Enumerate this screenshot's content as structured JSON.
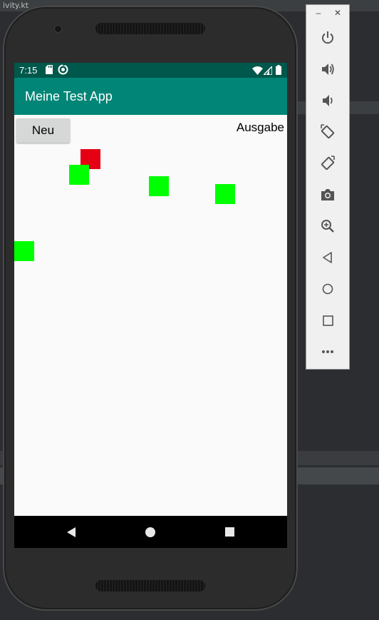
{
  "ide": {
    "tab_label": "ivity.kt"
  },
  "status_bar": {
    "time": "7:15",
    "icons": [
      "sd-card-icon",
      "sync-icon",
      "wifi-icon",
      "signal-icon",
      "battery-icon"
    ]
  },
  "app": {
    "title": "Meine Test App",
    "neu_button_label": "Neu",
    "ausgabe_label": "Ausgabe"
  },
  "colors": {
    "status_bar": "#00574b",
    "app_bar": "#008577",
    "green_square": "#00ff00",
    "red_square": "#e50013"
  },
  "squares": [
    {
      "color": "red",
      "name": "red-square"
    },
    {
      "color": "green",
      "name": "green-square"
    },
    {
      "color": "green",
      "name": "green-square"
    },
    {
      "color": "green",
      "name": "green-square"
    },
    {
      "color": "green",
      "name": "green-square"
    }
  ],
  "nav_bar": {
    "buttons": [
      "back-triangle-icon",
      "home-circle-icon",
      "recents-square-icon"
    ]
  },
  "emulator_toolbar": {
    "window_controls": [
      "minimize-icon",
      "close-icon"
    ],
    "buttons": [
      "power-icon",
      "volume-up-icon",
      "volume-down-icon",
      "rotate-left-icon",
      "rotate-right-icon",
      "camera-icon",
      "zoom-icon",
      "back-icon",
      "home-icon",
      "overview-icon",
      "more-icon"
    ]
  }
}
